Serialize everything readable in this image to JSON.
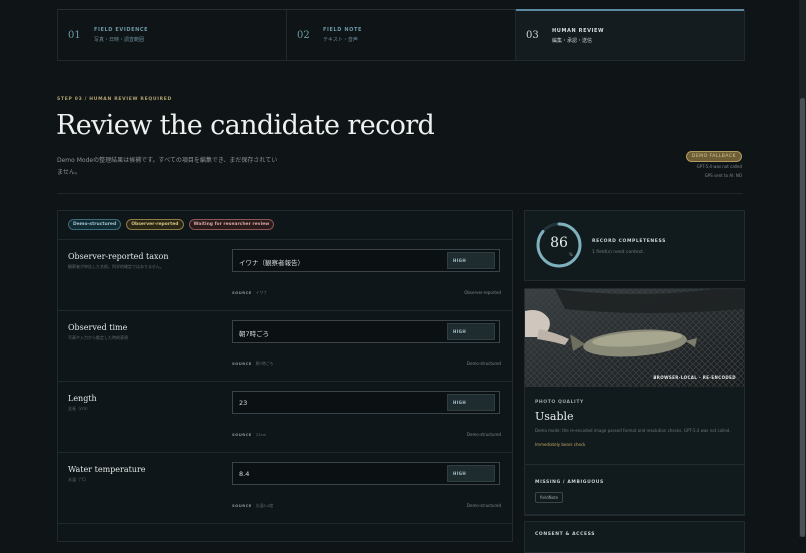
{
  "stepper": [
    {
      "num": "01",
      "title": "FIELD EVIDENCE",
      "sub": "写真・日時・調査範囲"
    },
    {
      "num": "02",
      "title": "FIELD NOTE",
      "sub": "テキスト・音声"
    },
    {
      "num": "03",
      "title": "HUMAN REVIEW",
      "sub": "編集・承認・送信"
    }
  ],
  "hero": {
    "eyebrow": "STEP 03 / HUMAN REVIEW REQUIRED",
    "title": "Review the candidate record",
    "description": "Demo Modeの整理結果は候補です。すべての項目を編集でき、まだ保存されていません。",
    "status_pill": "DEMO FALLBACK",
    "status_note1": "GPT-5.4 was not called",
    "status_note2": "GPS sent to AI: NO"
  },
  "chips": [
    "Demo-structured",
    "Observer-reported",
    "Waiting for researcher review"
  ],
  "fields": [
    {
      "label": "Observer-reported taxon",
      "hint": "観察者が申告した名前。科学的確定ではありません。",
      "value": "イワナ（観察者報告）",
      "confidence": "HIGH",
      "source_key": "SOURCE",
      "source_val": "イワナ",
      "origin": "Observer-reported"
    },
    {
      "label": "Observed time",
      "hint": "写真や入力から推定した時刻表現",
      "value": "朝7時ごろ",
      "confidence": "HIGH",
      "source_key": "SOURCE",
      "source_val": "朝7時ごろ",
      "origin": "Demo-structured"
    },
    {
      "label": "Length",
      "hint": "全長（cm）",
      "value": "23",
      "confidence": "HIGH",
      "source_key": "SOURCE",
      "source_val": "23cm",
      "origin": "Demo-structured"
    },
    {
      "label": "Water temperature",
      "hint": "水温（°C）",
      "value": "8.4",
      "confidence": "HIGH",
      "source_key": "SOURCE",
      "source_val": "水温8.4度",
      "origin": "Demo-structured"
    }
  ],
  "completeness": {
    "value": 86,
    "unit": "%",
    "label": "RECORD COMPLETENESS",
    "sub": "1 field(s) need context."
  },
  "photo": {
    "tag": "BROWSER-LOCAL · RE-ENCODED",
    "label": "PHOTO QUALITY",
    "title": "Usable",
    "desc": "Demo mode: the re-encoded image passed format and resolution checks. GPT-5.4 was not called.",
    "link": "Immediately bears check"
  },
  "missing": {
    "label": "MISSING / AMBIGUOUS",
    "chip": "fieldNote"
  },
  "consent": {
    "label": "CONSENT & ACCESS"
  },
  "colors": {
    "accent": "#6c9cab",
    "gold": "#b3a26d",
    "ring": "#7fb0bd"
  }
}
